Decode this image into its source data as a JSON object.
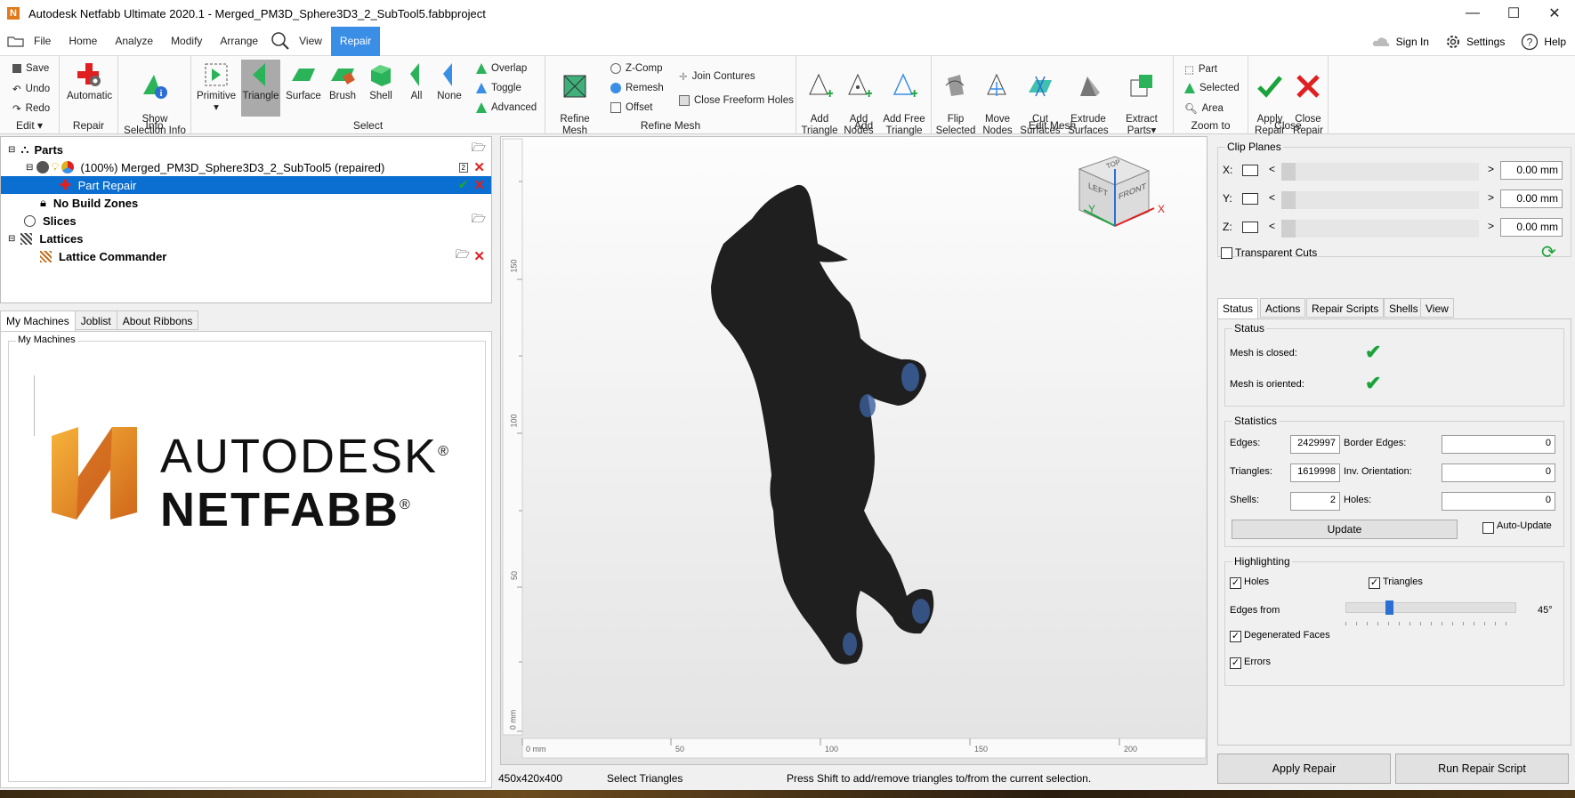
{
  "window": {
    "title": "Autodesk Netfabb Ultimate 2020.1 - Merged_PM3D_Sphere3D3_2_SubTool5.fabbproject",
    "logo_letter": "N"
  },
  "menu": {
    "items": [
      "File",
      "Home",
      "Analyze",
      "Modify",
      "Arrange",
      "View",
      "Repair"
    ],
    "active": "Repair",
    "sign_in": "Sign In",
    "settings": "Settings",
    "help": "Help"
  },
  "ribbon": {
    "edit": {
      "save": "Save",
      "undo": "Undo",
      "redo": "Redo",
      "label": "Edit ▾"
    },
    "repair": {
      "automatic": "Automatic",
      "label": "Repair"
    },
    "info": {
      "show_selection": "Show\nSelection Info",
      "label": "Info"
    },
    "select": {
      "primitive": "Primitive",
      "triangle": "Triangle",
      "surface": "Surface",
      "brush": "Brush",
      "shell": "Shell",
      "all": "All",
      "none": "None",
      "overlap": "Overlap",
      "toggle": "Toggle",
      "advanced": "Advanced",
      "label": "Select"
    },
    "refine": {
      "refine_mesh": "Refine\nMesh",
      "zcomp": "Z-Comp",
      "remesh": "Remesh",
      "offset": "Offset",
      "join": "Join Contures",
      "close_freeform": "Close Freeform Holes",
      "label": "Refine Mesh"
    },
    "add": {
      "add_triangle": "Add\nTriangle",
      "add_nodes": "Add\nNodes",
      "add_free": "Add Free\nTriangle",
      "label": "Add"
    },
    "edit_mesh": {
      "flip": "Flip\nSelected",
      "move": "Move\nNodes",
      "cut": "Cut\nSurfaces",
      "extrude": "Extrude\nSurfaces",
      "extract": "Extract\nParts",
      "label": "Edit Mesh"
    },
    "zoom": {
      "part": "Part",
      "selected": "Selected",
      "area": "Area",
      "label": "Zoom to"
    },
    "close": {
      "apply": "Apply\nRepair",
      "close": "Close\nRepair",
      "label": "Close"
    }
  },
  "tree": {
    "parts": "Parts",
    "part_count": "2",
    "part_name": "(100%) Merged_PM3D_Sphere3D3_2_SubTool5 (repaired)",
    "part_repair": "Part Repair",
    "no_build": "No Build Zones",
    "slices": "Slices",
    "lattices": "Lattices",
    "lattice_cmd": "Lattice Commander"
  },
  "left_tabs": [
    "My Machines",
    "Joblist",
    "About Ribbons"
  ],
  "machines": {
    "title": "My Machines",
    "brand_line1": "AUTODESK",
    "brand_line2": "NETFABB",
    "reg": "®"
  },
  "viewport": {
    "ruler_x": [
      "0 mm",
      "50",
      "100",
      "150",
      "200"
    ],
    "ruler_y": [
      "150",
      "100",
      "50",
      "0 mm"
    ],
    "axis_x": "X",
    "axis_y": "Y",
    "cube_left": "LEFT",
    "cube_front": "FRONT",
    "cube_top": "TOP"
  },
  "statusbar": {
    "dims": "450x420x400",
    "mode": "Select Triangles",
    "hint": "Press Shift to add/remove triangles to/from the current selection."
  },
  "clip": {
    "title": "Clip Planes",
    "axes": [
      "X:",
      "Y:",
      "Z:"
    ],
    "values": [
      "0.00 mm",
      "0.00 mm",
      "0.00 mm"
    ],
    "transparent": "Transparent Cuts"
  },
  "right_tabs": [
    "Status",
    "Actions",
    "Repair Scripts",
    "Shells",
    "View"
  ],
  "status": {
    "title": "Status",
    "closed": "Mesh is closed:",
    "oriented": "Mesh is oriented:"
  },
  "stats": {
    "title": "Statistics",
    "edges_l": "Edges:",
    "edges": "2429997",
    "tris_l": "Triangles:",
    "tris": "1619998",
    "shells_l": "Shells:",
    "shells": "2",
    "border_l": "Border Edges:",
    "border": "0",
    "inv_l": "Inv. Orientation:",
    "inv": "0",
    "holes_l": "Holes:",
    "holes": "0",
    "update": "Update",
    "auto": "Auto-Update"
  },
  "highlight": {
    "title": "Highlighting",
    "holes": "Holes",
    "triangles": "Triangles",
    "edges_from": "Edges from",
    "angle": "45°",
    "angle_fraction": 0.25,
    "degenerated": "Degenerated Faces",
    "errors": "Errors"
  },
  "bottom": {
    "apply": "Apply Repair",
    "run": "Run Repair Script"
  },
  "colors": {
    "accent": "#3a8ee6",
    "select": "#0b6fd1",
    "check": "#1aa33a",
    "red": "#e02020",
    "mesh": "#1f1f1f",
    "mesh_blue": "#3b5f9c"
  }
}
